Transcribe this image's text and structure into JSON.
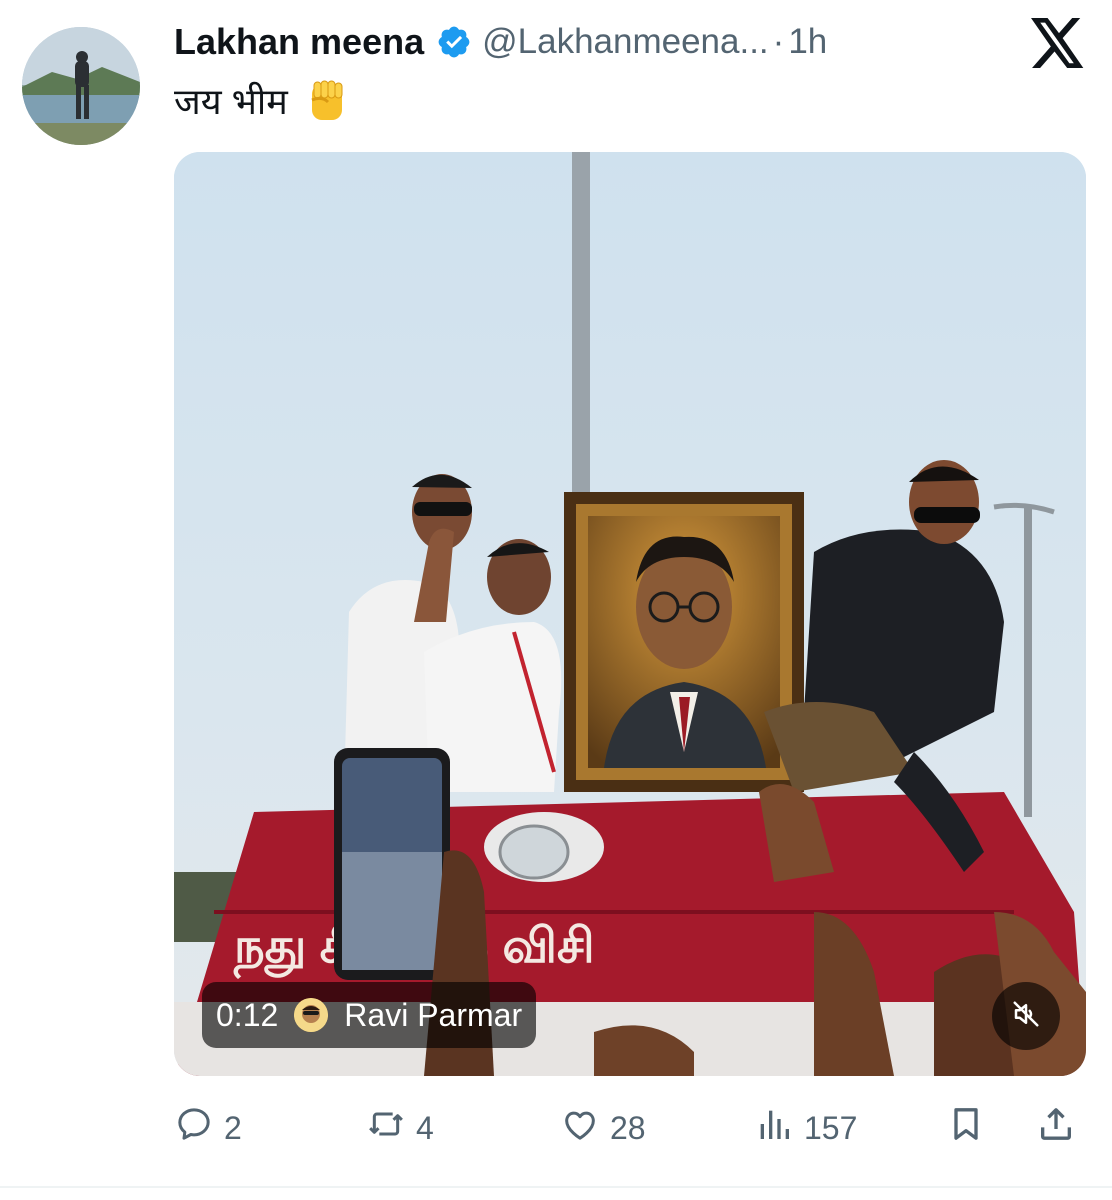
{
  "author": {
    "display_name": "Lakhan meena",
    "handle": "@Lakhanmeena...",
    "separator": "·",
    "time": "1h"
  },
  "tweet": {
    "text": "जय भीम"
  },
  "video": {
    "timestamp": "0:12",
    "credit_name": "Ravi Parmar"
  },
  "actions": {
    "replies": "2",
    "reposts": "4",
    "likes": "28",
    "views": "157"
  },
  "colors": {
    "verified": "#1d9bf0",
    "text_primary": "#0f1419",
    "text_secondary": "#536471"
  },
  "icons": {
    "verified": "verified-badge-icon",
    "x_logo": "x-logo-icon",
    "fist": "raised-fist-emoji-icon",
    "reply": "reply-icon",
    "repost": "repost-icon",
    "like": "heart-icon",
    "views": "views-chart-icon",
    "bookmark": "bookmark-icon",
    "share": "share-icon",
    "mute": "muted-speaker-icon"
  }
}
